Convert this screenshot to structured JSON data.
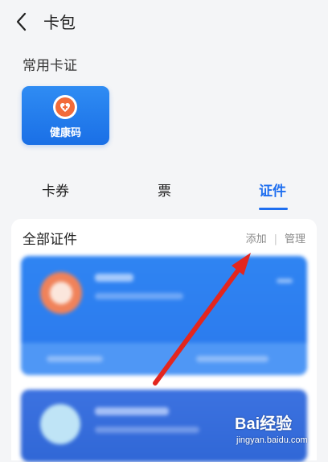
{
  "header": {
    "title": "卡包",
    "back_icon": "chevron-left-icon"
  },
  "common": {
    "section_title": "常用卡证",
    "card": {
      "label": "健康码",
      "icon": "heart-badge-icon",
      "color": "#1a6fe6"
    }
  },
  "tabs": [
    {
      "label": "卡券",
      "active": false
    },
    {
      "label": "票",
      "active": false
    },
    {
      "label": "证件",
      "active": true
    }
  ],
  "panel": {
    "title": "全部证件",
    "actions": {
      "add": "添加",
      "separator": "|",
      "manage": "管理"
    }
  },
  "annotation": {
    "arrow_color": "#e3261e"
  },
  "watermark": {
    "logo": "Bai经验",
    "url": "jingyan.baidu.com"
  },
  "colors": {
    "accent": "#1f6ff0",
    "card_blue": "#2c7cee",
    "card_dark_blue": "#3067d6"
  }
}
